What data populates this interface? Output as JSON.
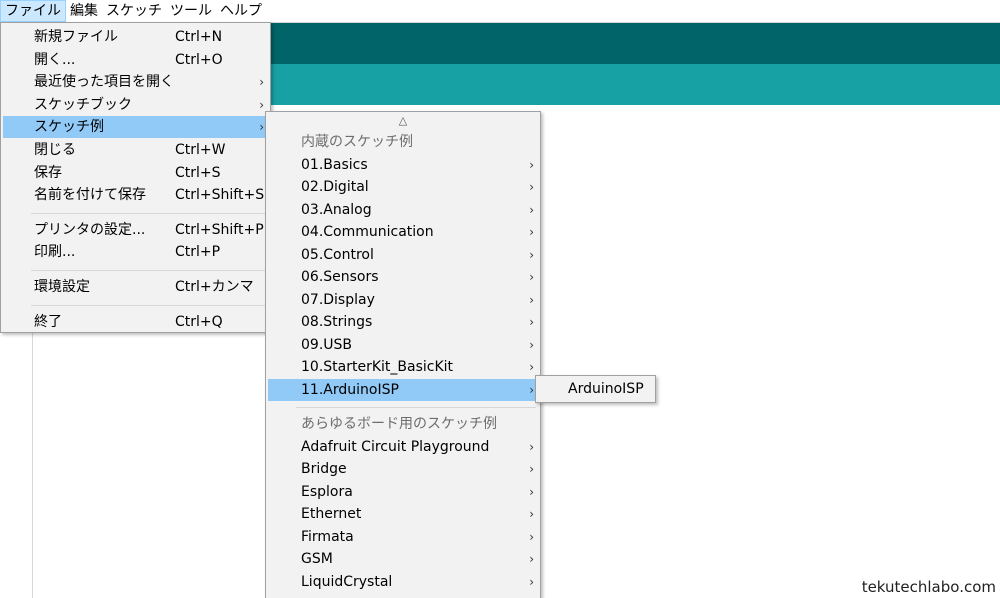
{
  "menubar": [
    "ファイル",
    "編集",
    "スケッチ",
    "ツール",
    "ヘルプ"
  ],
  "file_menu": [
    {
      "label": "新規ファイル",
      "shortcut": "Ctrl+N"
    },
    {
      "label": "開く...",
      "shortcut": "Ctrl+O"
    },
    {
      "label": "最近使った項目を開く",
      "submenu": true
    },
    {
      "label": "スケッチブック",
      "submenu": true
    },
    {
      "label": "スケッチ例",
      "submenu": true,
      "highlighted": true
    },
    {
      "label": "閉じる",
      "shortcut": "Ctrl+W"
    },
    {
      "label": "保存",
      "shortcut": "Ctrl+S"
    },
    {
      "label": "名前を付けて保存",
      "shortcut": "Ctrl+Shift+S"
    },
    {
      "separator": true
    },
    {
      "label": "プリンタの設定...",
      "shortcut": "Ctrl+Shift+P"
    },
    {
      "label": "印刷...",
      "shortcut": "Ctrl+P"
    },
    {
      "separator": true
    },
    {
      "label": "環境設定",
      "shortcut": "Ctrl+カンマ"
    },
    {
      "separator": true
    },
    {
      "label": "終了",
      "shortcut": "Ctrl+Q"
    }
  ],
  "sketch_menu": {
    "scroll_up": "△",
    "items": [
      {
        "label": "内蔵のスケッチ例",
        "header": true
      },
      {
        "label": "01.Basics",
        "submenu": true
      },
      {
        "label": "02.Digital",
        "submenu": true
      },
      {
        "label": "03.Analog",
        "submenu": true
      },
      {
        "label": "04.Communication",
        "submenu": true
      },
      {
        "label": "05.Control",
        "submenu": true
      },
      {
        "label": "06.Sensors",
        "submenu": true
      },
      {
        "label": "07.Display",
        "submenu": true
      },
      {
        "label": "08.Strings",
        "submenu": true
      },
      {
        "label": "09.USB",
        "submenu": true
      },
      {
        "label": "10.StarterKit_BasicKit",
        "submenu": true
      },
      {
        "label": "11.ArduinoISP",
        "submenu": true,
        "highlighted": true
      },
      {
        "separator": true
      },
      {
        "label": "あらゆるボード用のスケッチ例",
        "header": true
      },
      {
        "label": "Adafruit Circuit Playground",
        "submenu": true
      },
      {
        "label": "Bridge",
        "submenu": true
      },
      {
        "label": "Esplora",
        "submenu": true
      },
      {
        "label": "Ethernet",
        "submenu": true
      },
      {
        "label": "Firmata",
        "submenu": true
      },
      {
        "label": "GSM",
        "submenu": true
      },
      {
        "label": "LiquidCrystal",
        "submenu": true
      }
    ]
  },
  "isp_menu": {
    "label": "ArduinoISP"
  },
  "watermark": "tekutechlabo.com",
  "colors": {
    "toolbar_dark": "#006468",
    "toolbar_teal": "#17a1a5",
    "highlight": "#91c9f7"
  }
}
